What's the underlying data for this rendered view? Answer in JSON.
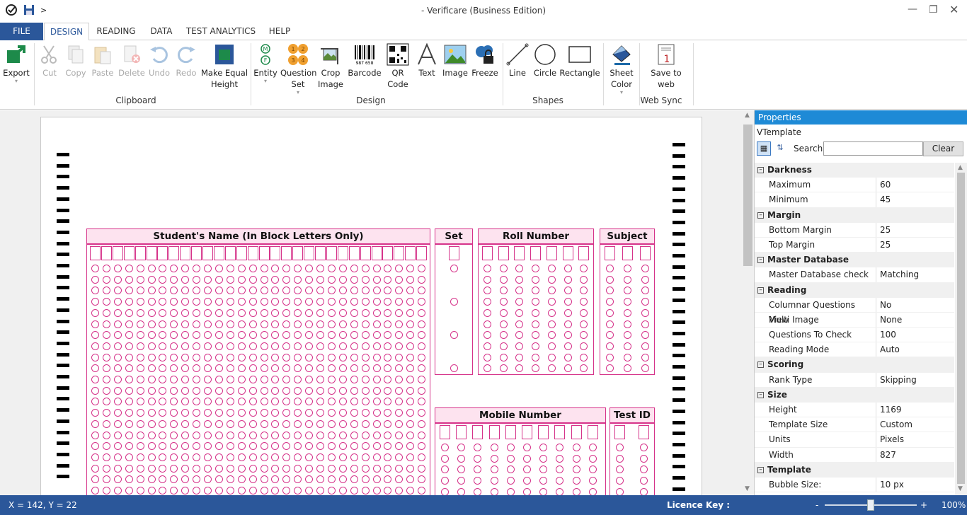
{
  "window": {
    "title": "- Verificare (Business Edition)",
    "breadcrumb": ">"
  },
  "tabs": [
    {
      "label": "FILE"
    },
    {
      "label": "DESIGN"
    },
    {
      "label": "READING"
    },
    {
      "label": "DATA"
    },
    {
      "label": "TEST ANALYTICS"
    },
    {
      "label": "HELP"
    }
  ],
  "ribbon": {
    "export": "Export",
    "cut": "Cut",
    "copy": "Copy",
    "paste": "Paste",
    "delete": "Delete",
    "undo": "Undo",
    "redo": "Redo",
    "make_equal_height_1": "Make Equal",
    "make_equal_height_2": "Height",
    "entity": "Entity",
    "question_set_1": "Question",
    "question_set_2": "Set",
    "crop_image_1": "Crop",
    "crop_image_2": "Image",
    "barcode": "Barcode",
    "qr_code_1": "QR",
    "qr_code_2": "Code",
    "text": "Text",
    "image": "Image",
    "freeze": "Freeze",
    "line": "Line",
    "circle": "Circle",
    "rectangle": "Rectangle",
    "sheet_color_1": "Sheet",
    "sheet_color_2": "Color",
    "save_to_web_1": "Save to",
    "save_to_web_2": "web",
    "groups": {
      "clipboard": "Clipboard",
      "design": "Design",
      "shapes": "Shapes",
      "web_sync": "Web Sync"
    },
    "barcode_digits": "987 658",
    "entity_badges": [
      "M",
      "F"
    ],
    "qset_badges": [
      "1",
      "2",
      "3",
      "4"
    ]
  },
  "sheet": {
    "name_header": "Student's Name (In Block Letters Only)",
    "set_header": "Set",
    "roll_header": "Roll Number",
    "subject_header": "Subject",
    "mobile_header": "Mobile Number",
    "testid_header": "Test ID"
  },
  "properties": {
    "header": "Properties",
    "object": "VTemplate",
    "search_label": "Search:",
    "search_value": "",
    "clear_button": "Clear",
    "categories": [
      {
        "name": "Darkness",
        "rows": [
          {
            "k": "Maximum",
            "v": "60"
          },
          {
            "k": "Minimum",
            "v": "45"
          }
        ]
      },
      {
        "name": "Margin",
        "rows": [
          {
            "k": "Bottom Margin",
            "v": "25"
          },
          {
            "k": "Top Margin",
            "v": "25"
          }
        ]
      },
      {
        "name": "Master Database",
        "rows": [
          {
            "k": "Master Database check",
            "v": "Matching"
          }
        ]
      },
      {
        "name": "Reading",
        "rows": [
          {
            "k": "Columnar Questions View",
            "v": "No"
          },
          {
            "k": "Multi Image",
            "v": "None"
          },
          {
            "k": "Questions To Check",
            "v": "100"
          },
          {
            "k": "Reading Mode",
            "v": "Auto"
          }
        ]
      },
      {
        "name": "Scoring",
        "rows": [
          {
            "k": "Rank Type",
            "v": "Skipping"
          }
        ]
      },
      {
        "name": "Size",
        "rows": [
          {
            "k": "Height",
            "v": "1169"
          },
          {
            "k": "Template Size",
            "v": "Custom"
          },
          {
            "k": "Units",
            "v": "Pixels"
          },
          {
            "k": "Width",
            "v": "827"
          }
        ]
      },
      {
        "name": "Template",
        "rows": [
          {
            "k": "Bubble Size:",
            "v": "10 px"
          }
        ]
      }
    ]
  },
  "status": {
    "coords": "X = 142, Y = 22",
    "licence": "Licence Key :",
    "zoom_minus": "-",
    "zoom_plus": "+",
    "zoom": "100%",
    "zoom_level": 0.5
  },
  "colors": {
    "accent": "#2b579a",
    "pink": "#d6338a",
    "pink_fill": "#fde3ef",
    "props_header": "#1e8ad6"
  }
}
